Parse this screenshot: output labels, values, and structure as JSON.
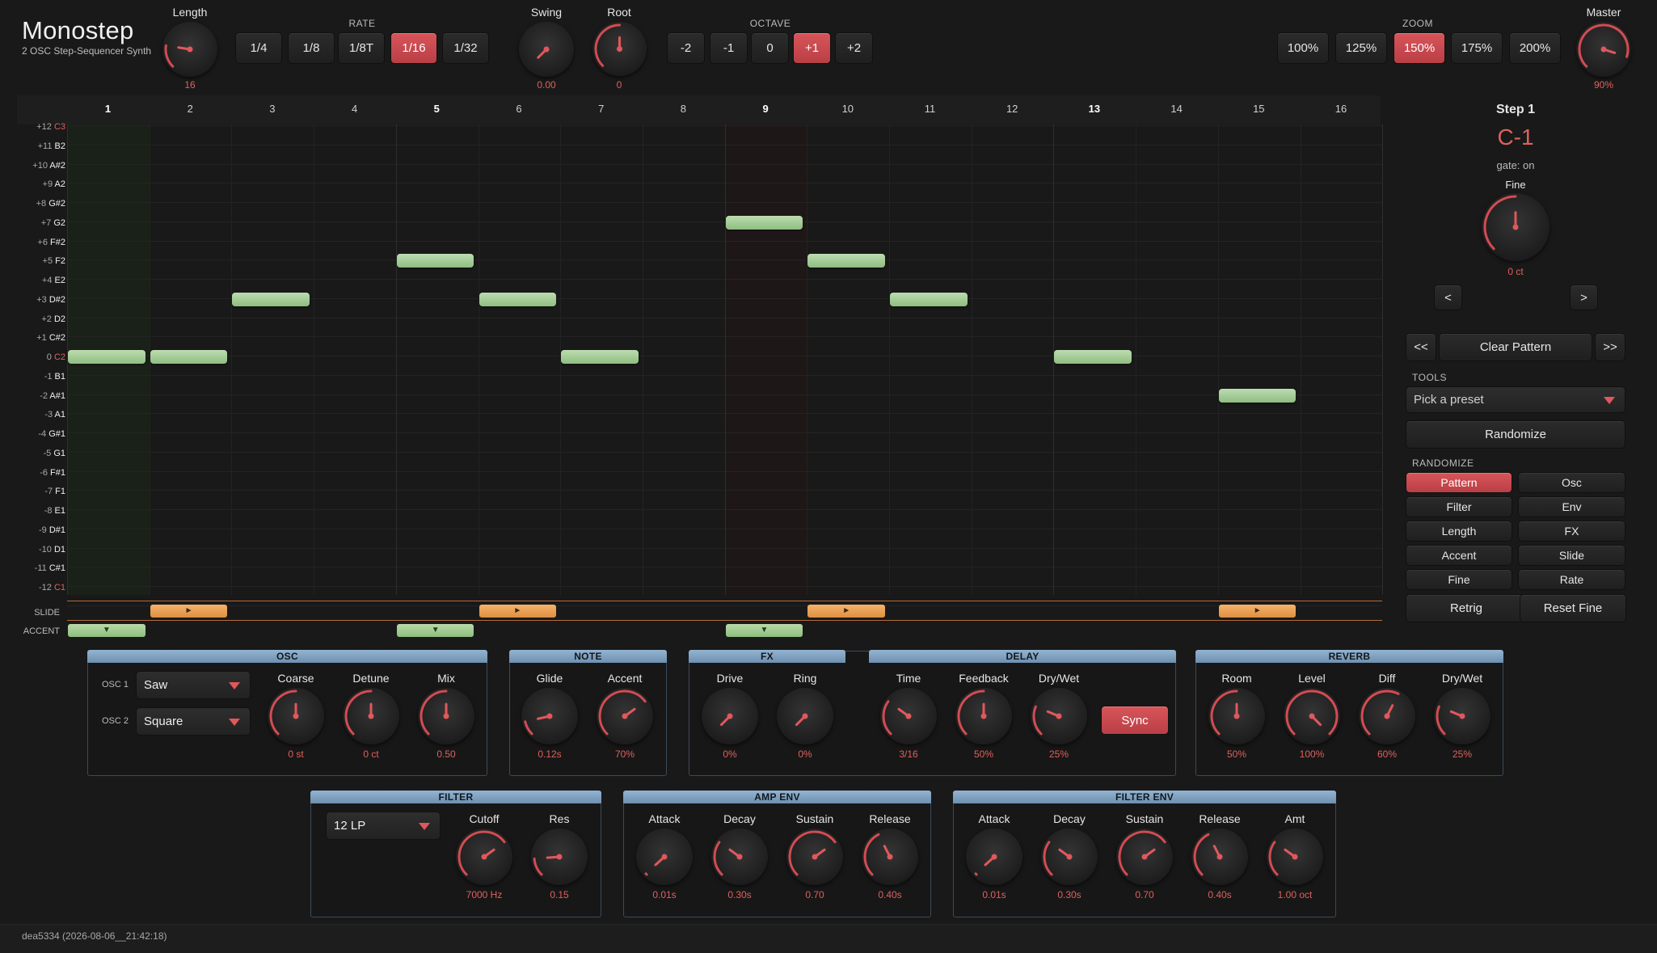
{
  "header": {
    "title": "Monostep",
    "subtitle": "2 OSC Step-Sequencer Synth",
    "length": {
      "label": "Length",
      "value": "16",
      "norm": 0.2
    },
    "rate": {
      "label": "RATE",
      "options": [
        "1/4",
        "1/8",
        "1/8T",
        "1/16",
        "1/32"
      ],
      "selected": 3
    },
    "swing": {
      "label": "Swing",
      "value": "0.00",
      "norm": 0.0
    },
    "root": {
      "label": "Root",
      "value": "0",
      "norm": 0.5
    },
    "octave": {
      "label": "OCTAVE",
      "options": [
        "-2",
        "-1",
        "0",
        "+1",
        "+2"
      ],
      "selected": 3
    },
    "zoom": {
      "label": "ZOOM",
      "options": [
        "100%",
        "125%",
        "150%",
        "175%",
        "200%"
      ],
      "selected": 2
    },
    "master": {
      "label": "Master",
      "value": "90%",
      "norm": 0.9
    }
  },
  "sequencer": {
    "columns": [
      "1",
      "2",
      "3",
      "4",
      "5",
      "6",
      "7",
      "8",
      "9",
      "10",
      "11",
      "12",
      "13",
      "14",
      "15",
      "16"
    ],
    "bold_columns": [
      1,
      5,
      9,
      13
    ],
    "rows": [
      {
        "n": "+12",
        "k": "C3",
        "red": true
      },
      {
        "n": "+11",
        "k": "B2"
      },
      {
        "n": "+10",
        "k": "A#2"
      },
      {
        "n": "+9",
        "k": "A2"
      },
      {
        "n": "+8",
        "k": "G#2"
      },
      {
        "n": "+7",
        "k": "G2"
      },
      {
        "n": "+6",
        "k": "F#2"
      },
      {
        "n": "+5",
        "k": "F2"
      },
      {
        "n": "+4",
        "k": "E2"
      },
      {
        "n": "+3",
        "k": "D#2"
      },
      {
        "n": "+2",
        "k": "D2"
      },
      {
        "n": "+1",
        "k": "C#2"
      },
      {
        "n": "0",
        "k": "C2",
        "red": true
      },
      {
        "n": "-1",
        "k": "B1"
      },
      {
        "n": "-2",
        "k": "A#1"
      },
      {
        "n": "-3",
        "k": "A1"
      },
      {
        "n": "-4",
        "k": "G#1"
      },
      {
        "n": "-5",
        "k": "G1"
      },
      {
        "n": "-6",
        "k": "F#1"
      },
      {
        "n": "-7",
        "k": "F1"
      },
      {
        "n": "-8",
        "k": "E1"
      },
      {
        "n": "-9",
        "k": "D#1"
      },
      {
        "n": "-10",
        "k": "D1"
      },
      {
        "n": "-11",
        "k": "C#1"
      },
      {
        "n": "-12",
        "k": "C1",
        "red": true
      }
    ],
    "notes": [
      {
        "step": 1,
        "semitone": 0
      },
      {
        "step": 2,
        "semitone": 0
      },
      {
        "step": 3,
        "semitone": 3
      },
      {
        "step": 5,
        "semitone": 5
      },
      {
        "step": 6,
        "semitone": 3
      },
      {
        "step": 7,
        "semitone": 0
      },
      {
        "step": 9,
        "semitone": 7
      },
      {
        "step": 10,
        "semitone": 5
      },
      {
        "step": 11,
        "semitone": 3
      },
      {
        "step": 13,
        "semitone": 0
      },
      {
        "step": 15,
        "semitone": -2
      }
    ],
    "slide_label": "SLIDE",
    "slide_steps": [
      2,
      6,
      10,
      15
    ],
    "slide_glyph": "►",
    "accent_label": "ACCENT",
    "accent_steps": [
      1,
      5,
      9
    ],
    "accent_glyph": "▼",
    "current_step": 1,
    "highlight_step": 9
  },
  "side": {
    "step_title": "Step 1",
    "note": "C-1",
    "gate": "gate: on",
    "fine": {
      "label": "Fine",
      "value": "0 ct",
      "norm": 0.5
    },
    "prev": "<",
    "next": ">",
    "first": "<<",
    "last": ">>",
    "clear": "Clear Pattern",
    "tools_label": "TOOLS",
    "preset_placeholder": "Pick a preset",
    "randomize": "Randomize",
    "randomize_label": "RANDOMIZE",
    "rand_buttons": [
      "Pattern",
      "Osc",
      "Filter",
      "Env",
      "Length",
      "FX",
      "Accent",
      "Slide",
      "Fine",
      "Rate"
    ],
    "rand_selected": 0,
    "retrig": "Retrig",
    "reset_fine": "Reset Fine"
  },
  "osc": {
    "title": "OSC",
    "osc1_label": "OSC 1",
    "osc1": "Saw",
    "osc2_label": "OSC 2",
    "osc2": "Square",
    "knobs": [
      {
        "label": "Coarse",
        "value": "0 st",
        "norm": 0.5
      },
      {
        "label": "Detune",
        "value": "0 ct",
        "norm": 0.5
      },
      {
        "label": "Mix",
        "value": "0.50",
        "norm": 0.5
      }
    ]
  },
  "note_panel": {
    "title": "NOTE",
    "knobs": [
      {
        "label": "Glide",
        "value": "0.12s",
        "norm": 0.12
      },
      {
        "label": "Accent",
        "value": "70%",
        "norm": 0.7
      }
    ]
  },
  "fx": {
    "title": "FX",
    "knobs": [
      {
        "label": "Drive",
        "value": "0%",
        "norm": 0.0
      },
      {
        "label": "Ring",
        "value": "0%",
        "norm": 0.0
      }
    ]
  },
  "delay": {
    "title": "DELAY",
    "knobs": [
      {
        "label": "Time",
        "value": "3/16",
        "norm": 0.3
      },
      {
        "label": "Feedback",
        "value": "50%",
        "norm": 0.5
      },
      {
        "label": "Dry/Wet",
        "value": "25%",
        "norm": 0.25
      }
    ],
    "sync": "Sync"
  },
  "reverb": {
    "title": "REVERB",
    "knobs": [
      {
        "label": "Room",
        "value": "50%",
        "norm": 0.5
      },
      {
        "label": "Level",
        "value": "100%",
        "norm": 1.0
      },
      {
        "label": "Diff",
        "value": "60%",
        "norm": 0.6
      },
      {
        "label": "Dry/Wet",
        "value": "25%",
        "norm": 0.25
      }
    ]
  },
  "filter": {
    "title": "FILTER",
    "type": "12 LP",
    "knobs": [
      {
        "label": "Cutoff",
        "value": "7000 Hz",
        "norm": 0.7
      },
      {
        "label": "Res",
        "value": "0.15",
        "norm": 0.15
      }
    ]
  },
  "amp_env": {
    "title": "AMP ENV",
    "knobs": [
      {
        "label": "Attack",
        "value": "0.01s",
        "norm": 0.01
      },
      {
        "label": "Decay",
        "value": "0.30s",
        "norm": 0.3
      },
      {
        "label": "Sustain",
        "value": "0.70",
        "norm": 0.7
      },
      {
        "label": "Release",
        "value": "0.40s",
        "norm": 0.4
      }
    ]
  },
  "filter_env": {
    "title": "FILTER ENV",
    "knobs": [
      {
        "label": "Attack",
        "value": "0.01s",
        "norm": 0.01
      },
      {
        "label": "Decay",
        "value": "0.30s",
        "norm": 0.3
      },
      {
        "label": "Sustain",
        "value": "0.70",
        "norm": 0.7
      },
      {
        "label": "Release",
        "value": "0.40s",
        "norm": 0.4
      },
      {
        "label": "Amt",
        "value": "1.00 oct",
        "norm": 0.3
      }
    ]
  },
  "footer": {
    "text": "dea5334 (2026-08-06__21:42:18)"
  },
  "colors": {
    "accent": "#d24c52",
    "value": "#e0605c",
    "note": "#a6cc95",
    "slide": "#ec9f50",
    "panel_header": "#7f9fbf"
  }
}
